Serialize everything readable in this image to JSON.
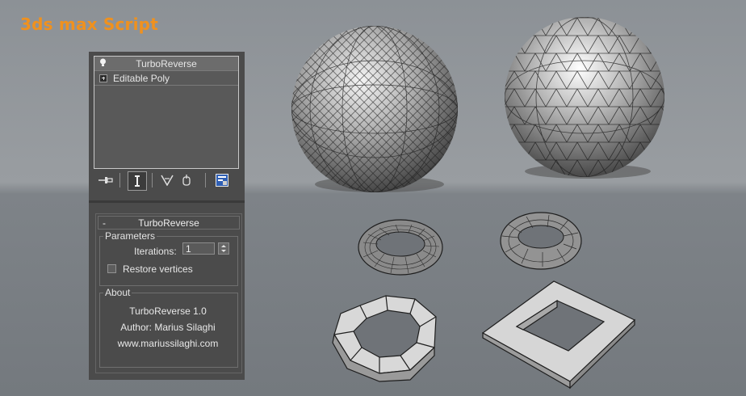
{
  "headline": "3ds max Script",
  "modifier_stack": [
    {
      "label": "TurboReverse",
      "icon": "lightbulb-icon"
    },
    {
      "label": "Editable Poly",
      "icon": "expand-plus-icon"
    }
  ],
  "toolbar": {
    "icons": [
      "pin-stack-icon",
      "show-end-result-icon",
      "make-unique-icon",
      "remove-modifier-icon",
      "configure-modifier-sets-icon"
    ]
  },
  "rollout": {
    "collapse": "-",
    "title": "TurboReverse",
    "parameters": {
      "legend": "Parameters",
      "iterations_label": "Iterations:",
      "iterations_value": "1",
      "restore_label": "Restore vertices",
      "restore_checked": false
    },
    "about": {
      "legend": "About",
      "name": "TurboReverse 1.0",
      "author": "Author: Marius Silaghi",
      "website": "www.mariussilaghi.com"
    }
  },
  "colors": {
    "headline": "#f0911e",
    "panel": "#4b4b4b",
    "viewport": "#8c9196"
  }
}
